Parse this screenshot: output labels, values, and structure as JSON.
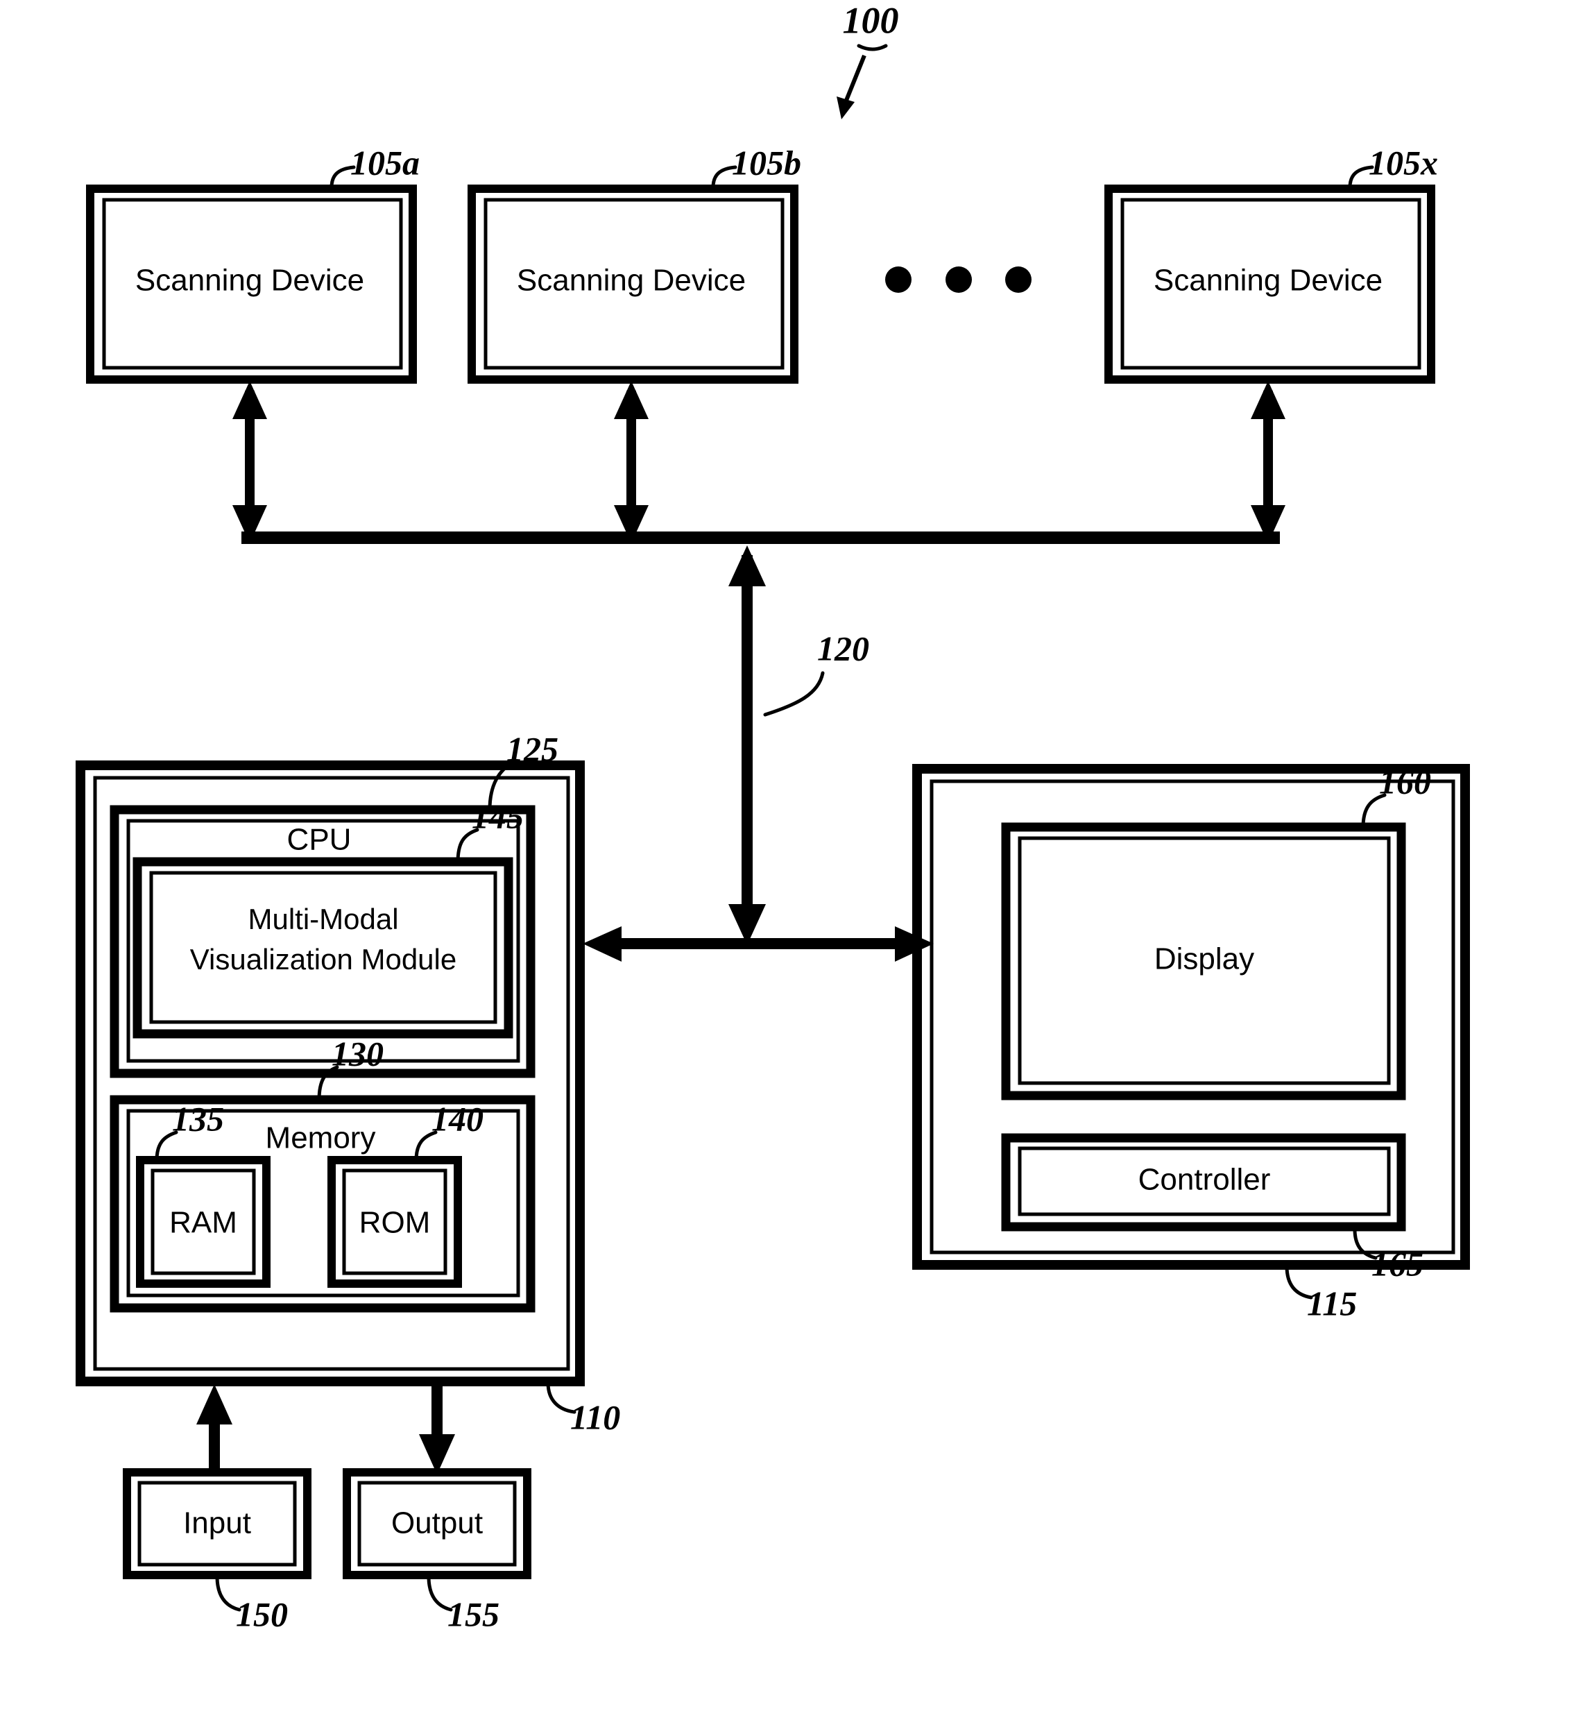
{
  "figure": {
    "number": "100",
    "title_ref": "100"
  },
  "scanning_devices": [
    {
      "label": "Scanning Device",
      "ref": "105a"
    },
    {
      "label": "Scanning Device",
      "ref": "105b"
    },
    {
      "label": "Scanning Device",
      "ref": "105x"
    }
  ],
  "ellipsis": {
    "name": "horizontal-ellipsis",
    "dots": 3
  },
  "bus": {
    "ref": "120"
  },
  "computer": {
    "ref": "110",
    "cpu": {
      "label": "CPU",
      "ref": "125"
    },
    "module": {
      "label_line1": "Multi-Modal",
      "label_line2": "Visualization Module",
      "ref": "145"
    },
    "memory": {
      "label": "Memory",
      "ref": "130"
    },
    "ram": {
      "label": "RAM",
      "ref": "135"
    },
    "rom": {
      "label": "ROM",
      "ref": "140"
    }
  },
  "display_unit": {
    "ref": "115",
    "display": {
      "label": "Display",
      "ref": "160"
    },
    "controller": {
      "label": "Controller",
      "ref": "165"
    }
  },
  "io": {
    "input": {
      "label": "Input",
      "ref": "150"
    },
    "output": {
      "label": "Output",
      "ref": "155"
    }
  },
  "colors": {
    "ink": "#000000",
    "paper": "#ffffff"
  }
}
